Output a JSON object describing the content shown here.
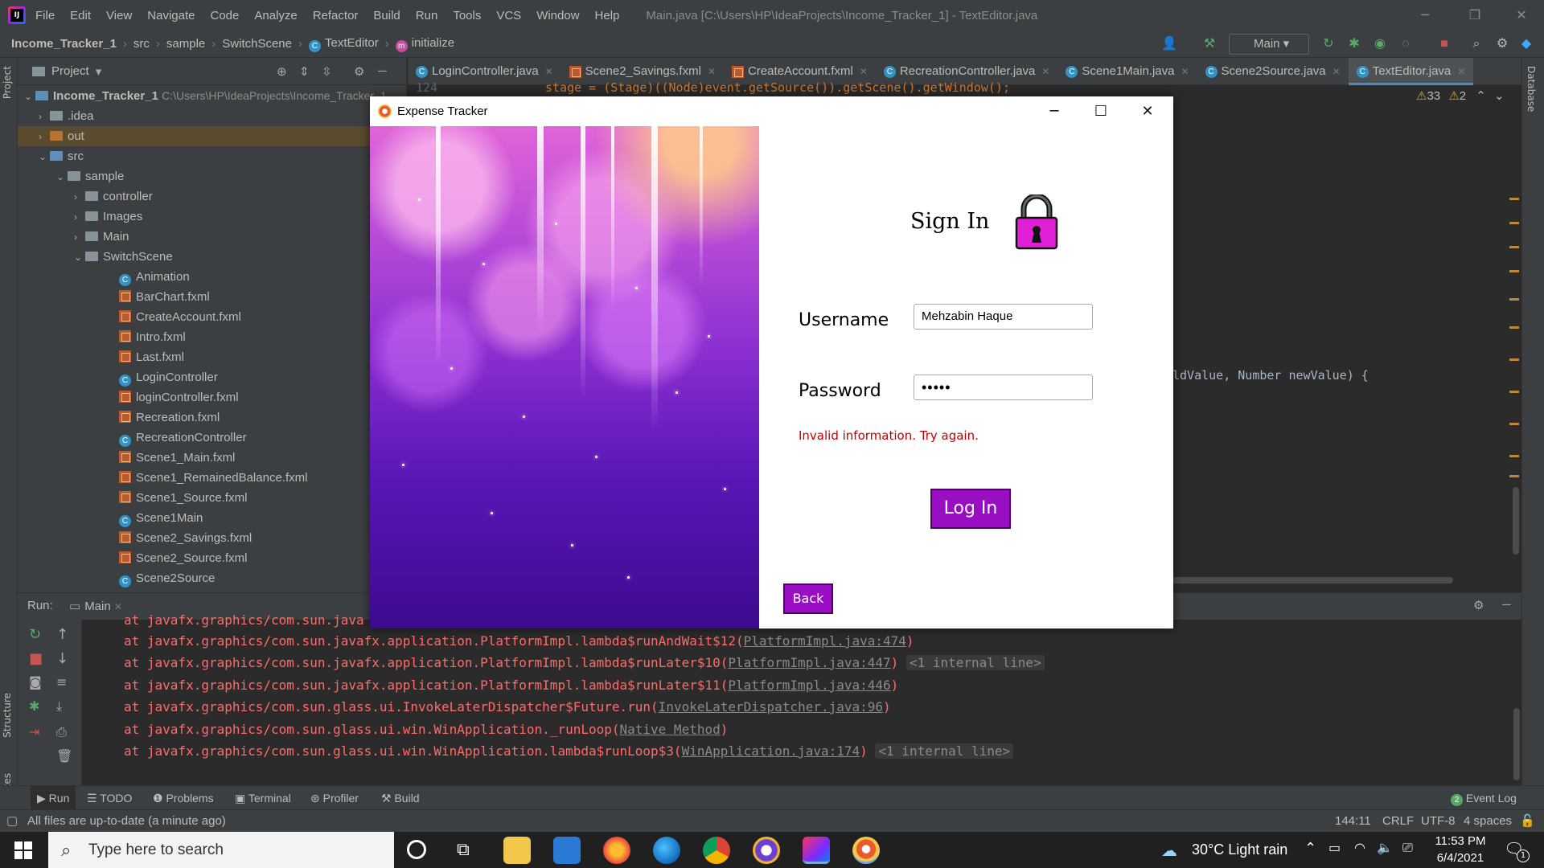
{
  "menu": {
    "items": [
      "File",
      "Edit",
      "View",
      "Navigate",
      "Code",
      "Analyze",
      "Refactor",
      "Build",
      "Run",
      "Tools",
      "VCS",
      "Window",
      "Help"
    ],
    "window_title": "Main.java [C:\\Users\\HP\\IdeaProjects\\Income_Tracker_1] - TextEditor.java"
  },
  "navbar": {
    "crumbs": [
      "Income_Tracker_1",
      "src",
      "sample",
      "SwitchScene",
      "TextEditor",
      "initialize"
    ],
    "run_config": "Main"
  },
  "project": {
    "title": "Project",
    "root_name": "Income_Tracker_1",
    "root_path": "C:\\Users\\HP\\IdeaProjects\\Income_Tracker_1",
    "items": [
      ".idea",
      "out",
      "src",
      "sample",
      "controller",
      "Images",
      "Main",
      "SwitchScene",
      "Animation",
      "BarChart.fxml",
      "CreateAccount.fxml",
      "Intro.fxml",
      "Last.fxml",
      "LoginController",
      "loginController.fxml",
      "Recreation.fxml",
      "RecreationController",
      "Scene1_Main.fxml",
      "Scene1_RemainedBalance.fxml",
      "Scene1_Source.fxml",
      "Scene1Main",
      "Scene2_Savings.fxml",
      "Scene2_Source.fxml",
      "Scene2Source"
    ]
  },
  "tabs": [
    "LoginController.java",
    "Scene2_Savings.fxml",
    "CreateAccount.fxml",
    "RecreationController.java",
    "Scene1Main.java",
    "Scene2Source.java",
    "TextEditor.java"
  ],
  "editor": {
    "line_number": "124",
    "code_top": "stage = (Stage)((Node)event.getSource()).getScene().getWindow();",
    "code_right": "ldValue, Number newValue) {",
    "warnings": "33",
    "weak_warnings": "2"
  },
  "run": {
    "label": "Run:",
    "config": "Main",
    "lines": [
      {
        "text": "at javafx.graphics/com.sun.javafx.application.PlatformImpl.lambda$runAndWait$12(",
        "link": "PlatformImpl.java:474",
        "end": ")",
        "internal": ""
      },
      {
        "text": "at javafx.graphics/com.sun.javafx.application.PlatformImpl.lambda$runLater$10(",
        "link": "PlatformImpl.java:447",
        "end": ")",
        "internal": "<1 internal line>"
      },
      {
        "text": "at javafx.graphics/com.sun.javafx.application.PlatformImpl.lambda$runLater$11(",
        "link": "PlatformImpl.java:446",
        "end": ")",
        "internal": ""
      },
      {
        "text": "at javafx.graphics/com.sun.glass.ui.InvokeLaterDispatcher$Future.run(",
        "link": "InvokeLaterDispatcher.java:96",
        "end": ")",
        "internal": ""
      },
      {
        "text": "at javafx.graphics/com.sun.glass.ui.win.WinApplication._runLoop(",
        "link": "Native Method",
        "end": ")",
        "internal": ""
      },
      {
        "text": "at javafx.graphics/com.sun.glass.ui.win.WinApplication.lambda$runLoop$3(",
        "link": "WinApplication.java:174",
        "end": ")",
        "internal": "<1 internal line>"
      }
    ],
    "first_line": "at javafx.graphics/com.sun.java"
  },
  "toolstrip": {
    "run": "Run",
    "todo": "TODO",
    "problems": "Problems",
    "terminal": "Terminal",
    "profiler": "Profiler",
    "build": "Build",
    "event_log": "Event Log",
    "event_count": "2"
  },
  "statusbar": {
    "message": "All files are up-to-date (a minute ago)",
    "position": "144:11",
    "line_sep": "CRLF",
    "encoding": "UTF-8",
    "indent": "4 spaces"
  },
  "taskbar": {
    "search_placeholder": "Type here to search",
    "weather": "30°C  Light rain",
    "time": "11:53 PM",
    "date": "6/4/2021",
    "notif": "1"
  },
  "dialog": {
    "title": "Expense Tracker",
    "heading": "Sign In",
    "username_label": "Username",
    "username_value": "Mehzabin Haque",
    "password_label": "Password",
    "password_value": "•••••",
    "error": "Invalid information. Try again.",
    "login_button": "Log In",
    "back_button": "Back"
  },
  "colors": {
    "accent": "#9a0ec3",
    "error": "#c00000",
    "ide_bg": "#2b2b2b",
    "panel": "#3c3f41"
  }
}
